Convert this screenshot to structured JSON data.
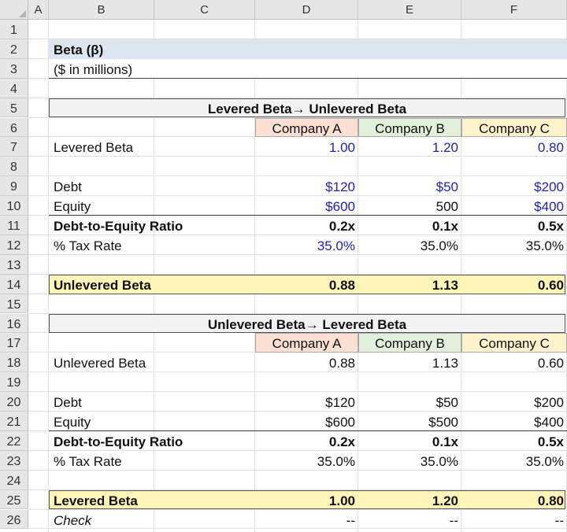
{
  "columns": [
    "A",
    "B",
    "C",
    "D",
    "E",
    "F"
  ],
  "rows": [
    "1",
    "2",
    "3",
    "4",
    "5",
    "6",
    "7",
    "8",
    "9",
    "10",
    "11",
    "12",
    "13",
    "14",
    "15",
    "16",
    "17",
    "18",
    "19",
    "20",
    "21",
    "22",
    "23",
    "24",
    "25",
    "26"
  ],
  "title": "Beta (β)",
  "subtitle": "($ in millions)",
  "section1": {
    "header": "Levered Beta→ Unlevered Beta",
    "companies": [
      "Company A",
      "Company B",
      "Company C"
    ],
    "levered_beta": {
      "label": "Levered Beta",
      "values": [
        "1.00",
        "1.20",
        "0.80"
      ]
    },
    "debt": {
      "label": "Debt",
      "values": [
        "$120",
        "$50",
        "$200"
      ]
    },
    "equity": {
      "label": "Equity",
      "values": [
        "$600",
        "500",
        "$400"
      ]
    },
    "de_ratio": {
      "label": "Debt-to-Equity Ratio",
      "values": [
        "0.2x",
        "0.1x",
        "0.5x"
      ]
    },
    "tax": {
      "label": "% Tax Rate",
      "values": [
        "35.0%",
        "35.0%",
        "35.0%"
      ]
    },
    "result": {
      "label": "Unlevered Beta",
      "values": [
        "0.88",
        "1.13",
        "0.60"
      ]
    }
  },
  "section2": {
    "header": "Unlevered Beta→ Levered Beta",
    "companies": [
      "Company A",
      "Company B",
      "Company C"
    ],
    "unlevered_beta": {
      "label": "Unlevered Beta",
      "values": [
        "0.88",
        "1.13",
        "0.60"
      ]
    },
    "debt": {
      "label": "Debt",
      "values": [
        "$120",
        "$50",
        "$200"
      ]
    },
    "equity": {
      "label": "Equity",
      "values": [
        "$600",
        "$500",
        "$400"
      ]
    },
    "de_ratio": {
      "label": "Debt-to-Equity Ratio",
      "values": [
        "0.2x",
        "0.1x",
        "0.5x"
      ]
    },
    "tax": {
      "label": "% Tax Rate",
      "values": [
        "35.0%",
        "35.0%",
        "35.0%"
      ]
    },
    "result": {
      "label": "Levered Beta",
      "values": [
        "1.00",
        "1.20",
        "0.80"
      ]
    },
    "check": {
      "label": "Check",
      "values": [
        "--",
        "--",
        "--"
      ]
    }
  },
  "colors": {
    "title_fill": "#dce6f1",
    "company_a_fill": "#fbe0d3",
    "company_b_fill": "#e2efda",
    "company_c_fill": "#fff2cc",
    "result_fill": "#fff5b8",
    "section_header_fill": "#f2f2f2",
    "input_blue": "#1f1fb4"
  }
}
